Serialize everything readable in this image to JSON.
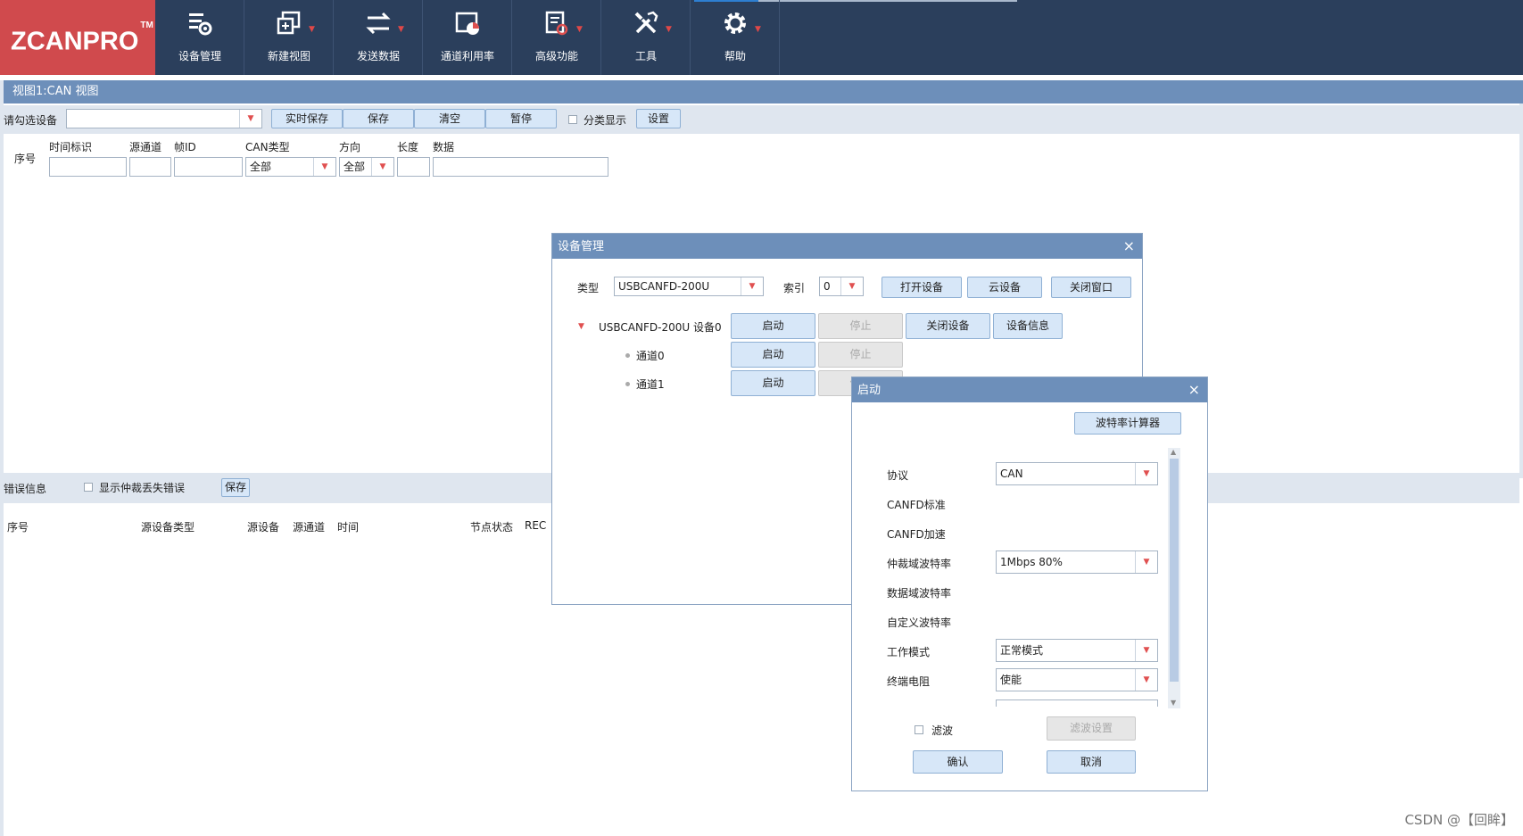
{
  "app": {
    "logo": "ZCANPRO",
    "logo_tm": "TM",
    "toolbar": [
      {
        "label": "设备管理",
        "icon": "device-manage-icon"
      },
      {
        "label": "新建视图",
        "icon": "new-view-icon"
      },
      {
        "label": "发送数据",
        "icon": "send-data-icon"
      },
      {
        "label": "通道利用率",
        "icon": "channel-usage-icon"
      },
      {
        "label": "高级功能",
        "icon": "advanced-icon"
      },
      {
        "label": "工具",
        "icon": "tools-icon"
      },
      {
        "label": "帮助",
        "icon": "gear-icon"
      }
    ]
  },
  "view": {
    "title": "视图1:CAN 视图",
    "device_select_label": "请勾选设备",
    "device_select_value": "",
    "buttons": {
      "realtime_save": "实时保存",
      "save": "保存",
      "clear": "清空",
      "pause": "暂停",
      "settings": "设置"
    },
    "classify_label": "分类显示",
    "columns": {
      "seq": "序号",
      "timestamp": "时间标识",
      "src_channel": "源通道",
      "frame_id": "帧ID",
      "can_type": "CAN类型",
      "direction": "方向",
      "length": "长度",
      "data": "数据"
    },
    "filters": {
      "can_type": "全部",
      "direction": "全部"
    }
  },
  "errors": {
    "label": "错误信息",
    "show_arbitration_lost": "显示仲裁丢失错误",
    "save": "保存",
    "columns": {
      "seq": "序号",
      "src_device_type": "源设备类型",
      "src_device": "源设备",
      "src_channel": "源通道",
      "time": "时间",
      "node_state": "节点状态",
      "rec": "REC"
    }
  },
  "device_dialog": {
    "title": "设备管理",
    "close": "×",
    "type_label": "类型",
    "type_value": "USBCANFD-200U",
    "index_label": "索引",
    "index_value": "0",
    "open_device": "打开设备",
    "cloud_device": "云设备",
    "close_window": "关闭窗口",
    "device_name": "USBCANFD-200U 设备0",
    "start": "启动",
    "stop": "停止",
    "close_device": "关闭设备",
    "device_info": "设备信息",
    "channels": [
      "通道0",
      "通道1"
    ]
  },
  "start_dialog": {
    "title": "启动",
    "close": "×",
    "baud_calc": "波特率计算器",
    "fields": {
      "protocol_label": "协议",
      "protocol_value": "CAN",
      "canfd_std_label": "CANFD标准",
      "canfd_accel_label": "CANFD加速",
      "arb_baud_label": "仲裁域波特率",
      "arb_baud_value": "1Mbps 80%",
      "data_baud_label": "数据域波特率",
      "custom_baud_label": "自定义波特率",
      "work_mode_label": "工作模式",
      "work_mode_value": "正常模式",
      "terminal_label": "终端电阻",
      "terminal_value": "使能"
    },
    "filter_label": "滤波",
    "filter_settings": "滤波设置",
    "confirm": "确认",
    "cancel": "取消"
  },
  "watermark": "CSDN @【回眸】"
}
